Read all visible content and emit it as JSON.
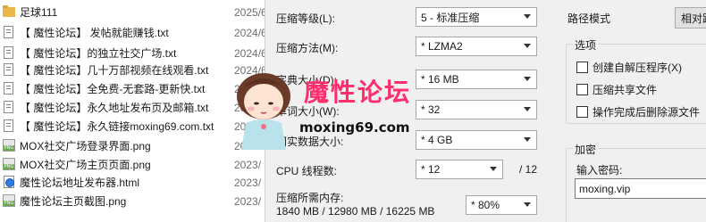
{
  "files": [
    {
      "name": "足球111",
      "date": "2025/6",
      "type": "folder"
    },
    {
      "name": "【 魔性论坛】 发帖就能赚钱.txt",
      "date": "2024/6",
      "type": "txt"
    },
    {
      "name": "【 魔性论坛】的独立社交广场.txt",
      "date": "2024/6",
      "type": "txt"
    },
    {
      "name": "【 魔性论坛】几十万部视频在线观看.txt",
      "date": "2024/6",
      "type": "txt"
    },
    {
      "name": "【 魔性论坛】全免费-无套路-更新快.txt",
      "date": "2024/6",
      "type": "txt"
    },
    {
      "name": "【 魔性论坛】永久地址发布页及邮箱.txt",
      "date": "2024/6",
      "type": "txt"
    },
    {
      "name": "【 魔性论坛】永久链接moxing69.com.txt",
      "date": "2024/6",
      "type": "txt"
    },
    {
      "name": "MOX社交广场登录界面.png",
      "date": "2023/",
      "type": "png"
    },
    {
      "name": "MOX社交广场主页页面.png",
      "date": "2023/",
      "type": "png"
    },
    {
      "name": "魔性论坛地址发布器.html",
      "date": "2023/",
      "type": "html"
    },
    {
      "name": "魔性论坛主页截图.png",
      "date": "2023/",
      "type": "png"
    }
  ],
  "dialog": {
    "level_label": "压缩等级(L):",
    "level_value": "5 - 标准压缩",
    "method_label": "压缩方法(M):",
    "method_value": "* LZMA2",
    "dict_label": "字典大小(D):",
    "dict_value": "* 16 MB",
    "word_label": "单词大小(W):",
    "word_value": "* 32",
    "solid_label": "固实数据大小:",
    "solid_value": "* 4 GB",
    "threads_label": "CPU 线程数:",
    "threads_value": "* 12",
    "threads_total": "/ 12",
    "memory_label": "压缩所需内存:",
    "memory_value": "1840 MB / 12980 MB / 16225 MB",
    "memory_pct": "* 80%",
    "path_mode_label": "路径模式",
    "path_mode_value": "相对路",
    "options_title": "选项",
    "opt_sfx": "创建自解压程序(X)",
    "opt_shared": "压缩共享文件",
    "opt_delete": "操作完成后删除源文件",
    "encrypt_title": "加密",
    "password_label": "输入密码:",
    "password_value": "moxing.vip"
  },
  "watermark": {
    "title": "魔性论坛",
    "url": "moxing69.com"
  }
}
